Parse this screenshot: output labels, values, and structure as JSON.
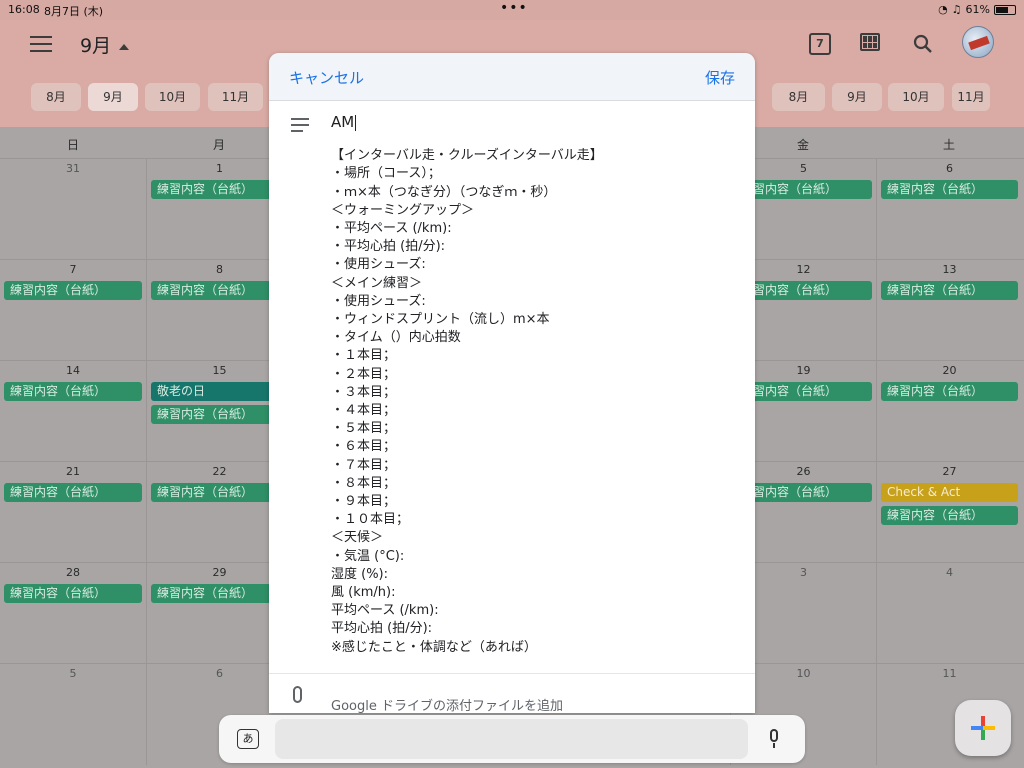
{
  "status": {
    "time": "16:08",
    "date": "8月7日 (木)",
    "battery": "61%",
    "dots": "•••"
  },
  "header": {
    "month": "9月",
    "today_icon_day": "7",
    "chips_left": [
      "8月",
      "9月",
      "10月",
      "11月"
    ],
    "chips_right": [
      "8月",
      "9月",
      "10月",
      "11月"
    ]
  },
  "calendar": {
    "weekdays": [
      "日",
      "月",
      "",
      "",
      "",
      "金",
      "土"
    ],
    "rows": [
      {
        "days": [
          "31",
          "1",
          "",
          "",
          "",
          "5",
          "6"
        ]
      },
      {
        "days": [
          "7",
          "8",
          "",
          "",
          "",
          "12",
          "13"
        ]
      },
      {
        "days": [
          "14",
          "15",
          "",
          "",
          "",
          "19",
          "20"
        ]
      },
      {
        "days": [
          "21",
          "22",
          "",
          "",
          "",
          "26",
          "27"
        ]
      },
      {
        "days": [
          "28",
          "29",
          "",
          "",
          "",
          "3",
          "4"
        ]
      },
      {
        "days": [
          "5",
          "6",
          "",
          "",
          "",
          "10",
          "11"
        ]
      }
    ],
    "event_label": "練習内容（台紙）",
    "holiday_label": "敬老の日",
    "check_label": "Check & Act",
    "colors": {
      "event": "#2f8f66",
      "holiday": "#17766c",
      "check": "#c8a11b"
    }
  },
  "modal": {
    "cancel": "キャンセル",
    "save": "保存",
    "title_value": "AM",
    "lines": [
      "【インターバル走・クルーズインターバル走】",
      "・場所（コース）；",
      "・ｍ×本（つなぎ分）（つなぎｍ・秒）",
      "＜ウォーミングアップ＞",
      "・平均ペース (/km):",
      "・平均心拍 (拍/分):",
      "・使用シューズ:",
      "＜メイン練習＞",
      "・使用シューズ:",
      "・ウィンドスプリント（流し）m×本",
      "・タイム（）内心拍数",
      "・１本目；",
      "・２本目；",
      "・３本目；",
      "・４本目；",
      "・５本目；",
      "・６本目；",
      "・７本目；",
      "・８本目；",
      "・９本目；",
      "・１０本目；",
      "＜天候＞",
      "・気温 (°C):",
      "湿度 (%):",
      "風 (km/h):",
      "平均ペース (/km):",
      "平均心拍 (拍/分):",
      "※感じたこと・体調など（あれば）"
    ],
    "attach_label": "Google ドライブの添付ファイルを追加"
  },
  "keyboard": {
    "ime_label": "あ"
  }
}
